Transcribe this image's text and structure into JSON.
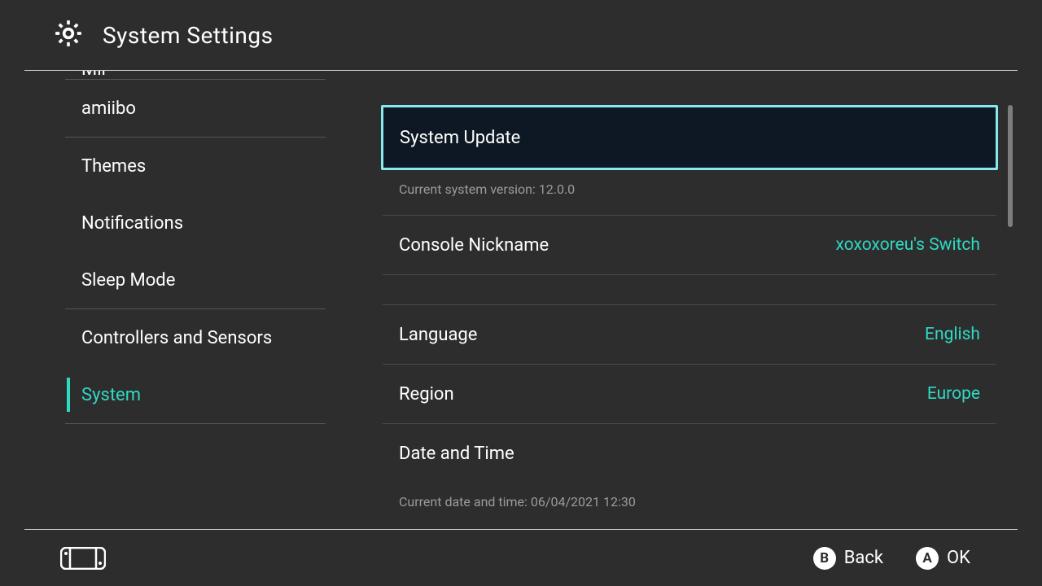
{
  "header": {
    "title": "System Settings"
  },
  "sidebar": {
    "partial_top": "Mii",
    "items": [
      {
        "label": "amiibo"
      },
      {
        "label": "Themes"
      },
      {
        "label": "Notifications"
      },
      {
        "label": "Sleep Mode"
      },
      {
        "label": "Controllers and Sensors"
      },
      {
        "label": "System",
        "active": true
      }
    ]
  },
  "main": {
    "system_update": {
      "label": "System Update",
      "subtext": "Current system version: 12.0.0"
    },
    "console_nickname": {
      "label": "Console Nickname",
      "value": "xoxoxoreu's Switch"
    },
    "language": {
      "label": "Language",
      "value": "English"
    },
    "region": {
      "label": "Region",
      "value": "Europe"
    },
    "date_time": {
      "label": "Date and Time",
      "subtext": "Current date and time: 06/04/2021 12:30"
    }
  },
  "footer": {
    "back": "Back",
    "ok": "OK"
  }
}
